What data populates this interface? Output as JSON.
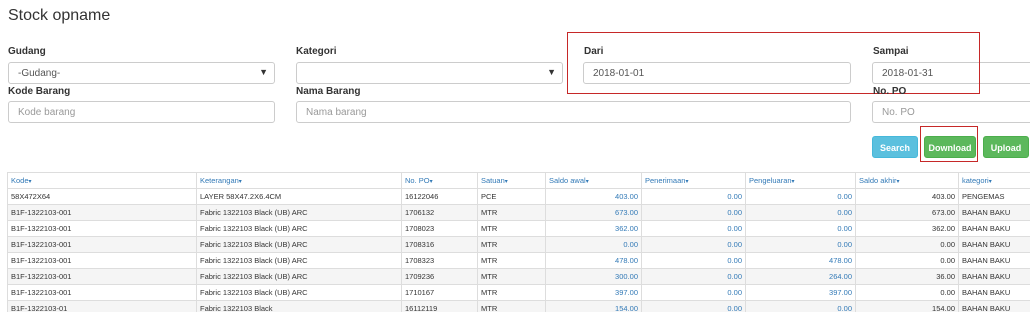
{
  "page": {
    "title": "Stock opname"
  },
  "filters": {
    "gudang_label": "Gudang",
    "gudang_value": "-Gudang-",
    "kategori_label": "Kategori",
    "kategori_value": "",
    "dari_label": "Dari",
    "dari_value": "2018-01-01",
    "sampai_label": "Sampai",
    "sampai_value": "2018-01-31",
    "kode_label": "Kode Barang",
    "kode_placeholder": "Kode barang",
    "nama_label": "Nama Barang",
    "nama_placeholder": "Nama barang",
    "po_label": "No. PO",
    "po_placeholder": "No. PO"
  },
  "buttons": {
    "search": "Search",
    "download": "Download",
    "upload": "Upload"
  },
  "table": {
    "sort_icon": "▾",
    "headers": [
      "Kode",
      "Keterangan",
      "No. PO",
      "Satuan",
      "Saldo awal",
      "Penerimaan",
      "Pengeluaran",
      "Saldo akhir",
      "kategori"
    ],
    "rows": [
      [
        "58X472X64",
        "LAYER 58X47.2X6.4CM",
        "16122046",
        "PCE",
        "403.00",
        "0.00",
        "0.00",
        "403.00",
        "PENGEMAS"
      ],
      [
        "B1F-1322103-001",
        "Fabric 1322103 Black (UB) ARC",
        "1706132",
        "MTR",
        "673.00",
        "0.00",
        "0.00",
        "673.00",
        "BAHAN BAKU"
      ],
      [
        "B1F-1322103-001",
        "Fabric 1322103 Black (UB) ARC",
        "1708023",
        "MTR",
        "362.00",
        "0.00",
        "0.00",
        "362.00",
        "BAHAN BAKU"
      ],
      [
        "B1F-1322103-001",
        "Fabric 1322103 Black (UB) ARC",
        "1708316",
        "MTR",
        "0.00",
        "0.00",
        "0.00",
        "0.00",
        "BAHAN BAKU"
      ],
      [
        "B1F-1322103-001",
        "Fabric 1322103 Black (UB) ARC",
        "1708323",
        "MTR",
        "478.00",
        "0.00",
        "478.00",
        "0.00",
        "BAHAN BAKU"
      ],
      [
        "B1F-1322103-001",
        "Fabric 1322103 Black (UB) ARC",
        "1709236",
        "MTR",
        "300.00",
        "0.00",
        "264.00",
        "36.00",
        "BAHAN BAKU"
      ],
      [
        "B1F-1322103-001",
        "Fabric 1322103 Black (UB) ARC",
        "1710167",
        "MTR",
        "397.00",
        "0.00",
        "397.00",
        "0.00",
        "BAHAN BAKU"
      ],
      [
        "B1F-1322103-01",
        "Fabric 1322103 Black",
        "16112119",
        "MTR",
        "154.00",
        "0.00",
        "0.00",
        "154.00",
        "BAHAN BAKU"
      ]
    ]
  }
}
